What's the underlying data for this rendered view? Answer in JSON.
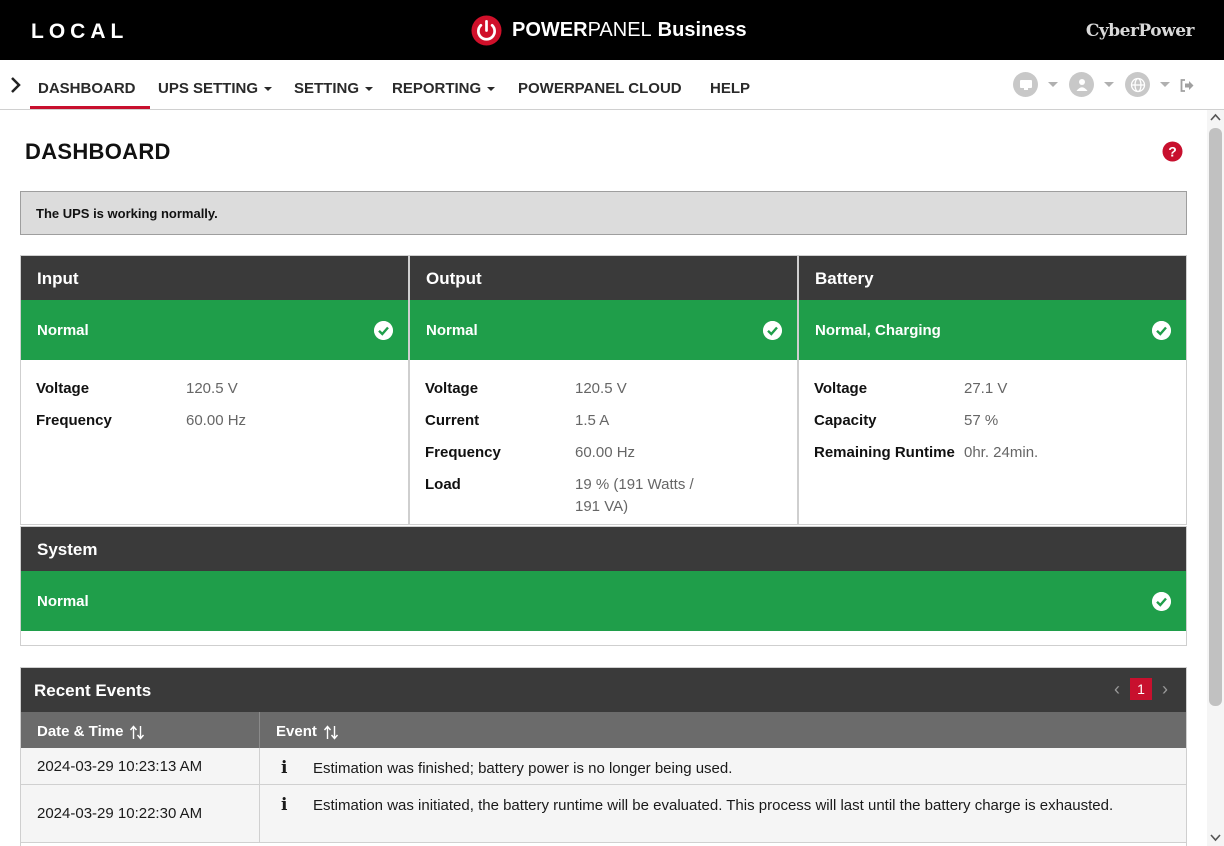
{
  "topbar": {
    "mode": "LOCAL",
    "brand_power": "POWER",
    "brand_panel": "PANEL",
    "brand_business": "Business",
    "vendor": "CyberPower"
  },
  "nav": {
    "items": [
      {
        "label": "DASHBOARD",
        "active": true
      },
      {
        "label": "UPS SETTING",
        "dropdown": true
      },
      {
        "label": "SETTING",
        "dropdown": true
      },
      {
        "label": "REPORTING",
        "dropdown": true
      },
      {
        "label": "POWERPANEL CLOUD"
      },
      {
        "label": "HELP"
      }
    ],
    "right_icons": [
      "monitor-icon",
      "user-icon",
      "globe-icon",
      "logout-icon"
    ]
  },
  "page": {
    "title": "DASHBOARD",
    "status_message": "The UPS is working normally."
  },
  "panels": {
    "input": {
      "title": "Input",
      "status": "Normal",
      "rows": [
        {
          "label": "Voltage",
          "value": "120.5 V"
        },
        {
          "label": "Frequency",
          "value": "60.00 Hz"
        }
      ]
    },
    "output": {
      "title": "Output",
      "status": "Normal",
      "rows": [
        {
          "label": "Voltage",
          "value": "120.5 V"
        },
        {
          "label": "Current",
          "value": "1.5 A"
        },
        {
          "label": "Frequency",
          "value": "60.00 Hz"
        },
        {
          "label": "Load",
          "value": "19 % (191 Watts / 191 VA)"
        }
      ]
    },
    "battery": {
      "title": "Battery",
      "status": "Normal, Charging",
      "rows": [
        {
          "label": "Voltage",
          "value": "27.1 V"
        },
        {
          "label": "Capacity",
          "value": "57 %"
        },
        {
          "label": "Remaining Runtime",
          "value": "0hr. 24min."
        }
      ]
    },
    "system": {
      "title": "System",
      "status": "Normal"
    }
  },
  "events": {
    "title": "Recent Events",
    "current_page": "1",
    "columns": [
      "Date & Time",
      "Event"
    ],
    "rows": [
      {
        "datetime": "2024-03-29 10:23:13 AM",
        "event": "Estimation was finished; battery power is no longer being used."
      },
      {
        "datetime": "2024-03-29 10:22:30 AM",
        "event": "Estimation was initiated, the battery runtime will be evaluated. This process will last until the battery charge is exhausted."
      }
    ]
  },
  "colors": {
    "accent_red": "#c8102e",
    "status_green": "#1f9e4a",
    "header_dark": "#3a3a3a"
  }
}
